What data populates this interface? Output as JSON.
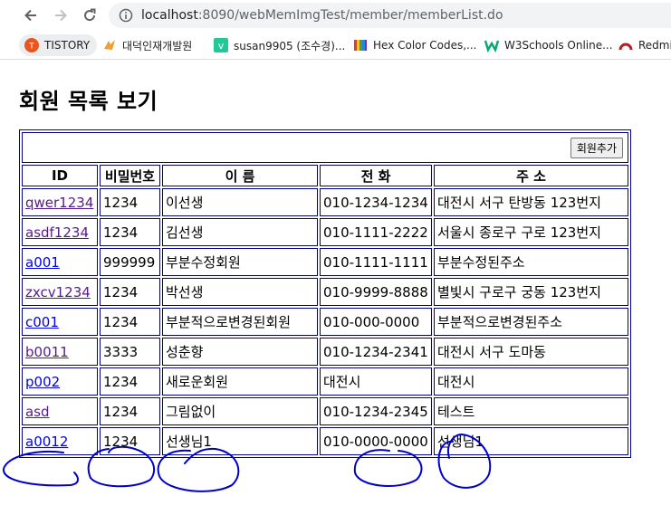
{
  "browser": {
    "url_host": "localhost",
    "url_path": ":8090/webMemImgTest/member/memberList.do",
    "bookmarks": [
      {
        "label": "TISTORY",
        "icon": "tistory-icon"
      },
      {
        "label": "대덕인재개발원",
        "icon": "daedeok-icon"
      },
      {
        "label": "susan9905 (조수경)...",
        "icon": "velog-icon"
      },
      {
        "label": "Hex Color Codes,...",
        "icon": "color-book-icon"
      },
      {
        "label": "W3Schools Online...",
        "icon": "w3schools-icon"
      },
      {
        "label": "Redmi",
        "icon": "redmine-icon"
      }
    ]
  },
  "page": {
    "title": "회원 목록 보기",
    "add_button": "회원추가",
    "headers": [
      "ID",
      "비밀번호",
      "이 름",
      "전 화",
      "주 소"
    ],
    "members": [
      {
        "id": "qwer1234",
        "pw": "1234",
        "name": "이선생",
        "tel": "010-1234-1234",
        "addr": "대전시 서구 탄방동 123번지"
      },
      {
        "id": "asdf1234",
        "pw": "1234",
        "name": "김선생",
        "tel": "010-1111-2222",
        "addr": "서울시 종로구 구로 123번지"
      },
      {
        "id": "a001",
        "pw": "999999",
        "name": "부분수정회원",
        "tel": "010-1111-1111",
        "addr": "부분수정된주소"
      },
      {
        "id": "zxcv1234",
        "pw": "1234",
        "name": "박선생",
        "tel": "010-9999-8888",
        "addr": "별빛시 구로구 궁동 123번지"
      },
      {
        "id": "c001",
        "pw": "1234",
        "name": "부분적으로변경된회원",
        "tel": "010-000-0000",
        "addr": "부분적으로변경된주소"
      },
      {
        "id": "b0011",
        "pw": "3333",
        "name": "성춘향",
        "tel": "010-1234-2341",
        "addr": "대전시 서구 도마동"
      },
      {
        "id": "p002",
        "pw": "1234",
        "name": "새로운회원",
        "tel": "대전시",
        "addr": "대전시"
      },
      {
        "id": "asd",
        "pw": "1234",
        "name": "그림없이",
        "tel": "010-1234-2345",
        "addr": "테스트"
      },
      {
        "id": "a0012",
        "pw": "1234",
        "name": "선생님1",
        "tel": "010-0000-0000",
        "addr": "선생님1"
      }
    ]
  },
  "colors": {
    "table_border": "#00008b",
    "link_visited": "#551a8b",
    "link_unvisited": "#0000ee",
    "annotation_ink": "#0000cc"
  }
}
